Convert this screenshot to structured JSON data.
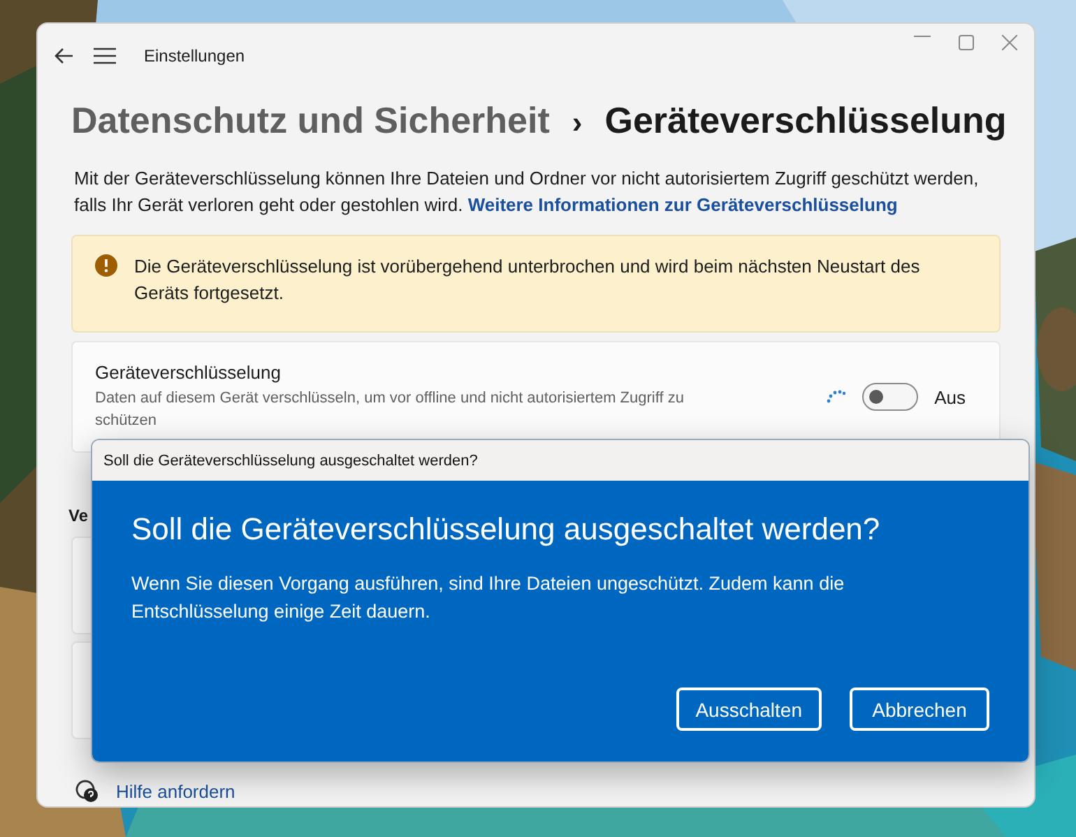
{
  "window": {
    "title": "Einstellungen"
  },
  "breadcrumb": [
    {
      "label": "Datenschutz und Sicherheit",
      "current": false
    },
    {
      "label": "Geräteverschlüsselung",
      "current": true
    }
  ],
  "breadcrumb_separator": "›",
  "intro": {
    "text": "Mit der Geräteverschlüsselung können Ihre Dateien und Ordner vor nicht autorisiertem Zugriff geschützt werden, falls Ihr Gerät verloren geht oder gestohlen wird.",
    "link": "Weitere Informationen zur Geräteverschlüsselung"
  },
  "warning": {
    "text": "Die Geräteverschlüsselung ist vorübergehend unterbrochen und wird beim nächsten Neustart des Geräts fortgesetzt."
  },
  "setting": {
    "title": "Geräteverschlüsselung",
    "description": "Daten auf diesem Gerät verschlüsseln, um vor offline und nicht autorisiertem Zugriff zu schützen",
    "busy": true,
    "on": false,
    "state_label": "Aus"
  },
  "section_heading": "Ve",
  "help_link": "Hilfe anfordern",
  "dialog": {
    "caption": "Soll die Geräteverschlüsselung ausgeschaltet werden?",
    "heading": "Soll die Geräteverschlüsselung ausgeschaltet werden?",
    "message": "Wenn Sie diesen Vorgang ausführen, sind Ihre Dateien ungeschützt. Zudem kann die Entschlüsselung einige Zeit dauern.",
    "buttons": [
      "Ausschalten",
      "Abbrechen"
    ]
  }
}
